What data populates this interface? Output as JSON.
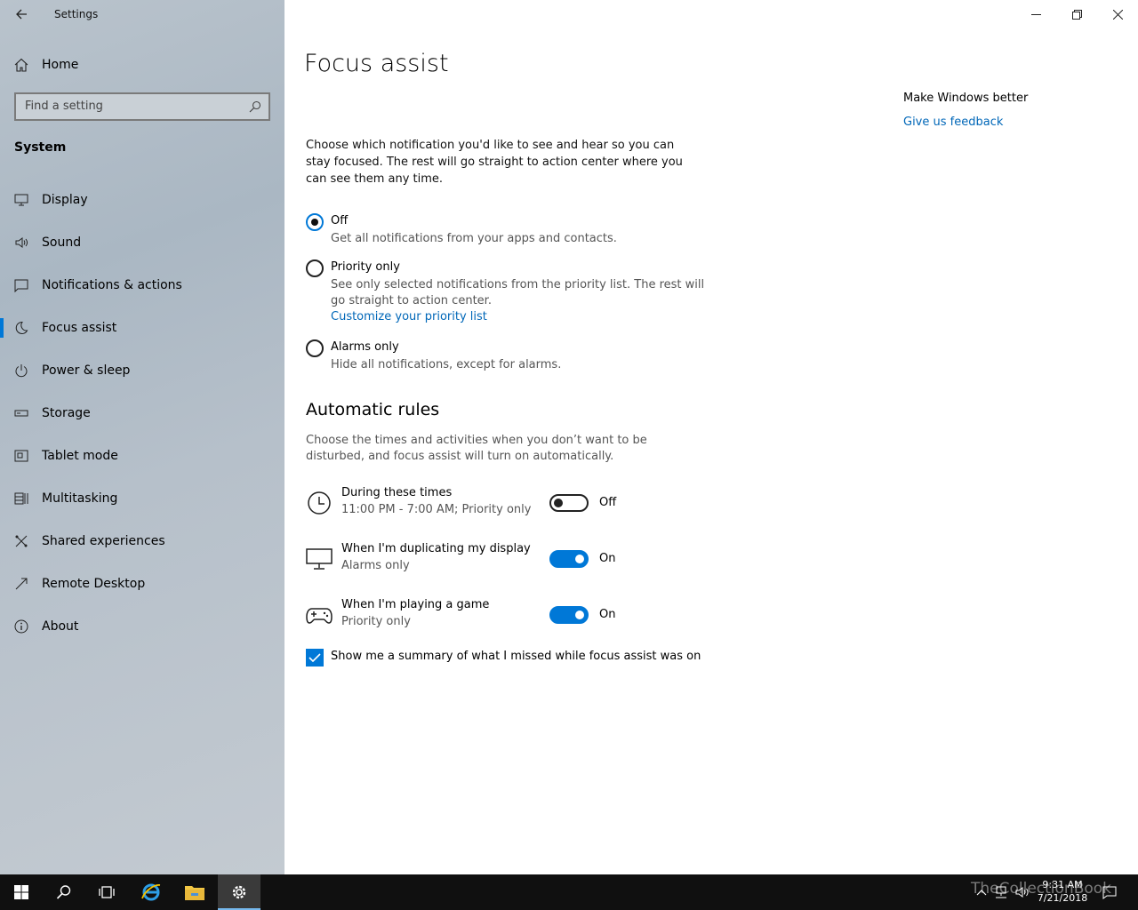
{
  "window": {
    "app_title": "Settings"
  },
  "sidebar": {
    "home_label": "Home",
    "search_placeholder": "Find a setting",
    "section_title": "System",
    "items": [
      {
        "label": "Display",
        "icon": "display-icon"
      },
      {
        "label": "Sound",
        "icon": "sound-icon"
      },
      {
        "label": "Notifications & actions",
        "icon": "notifications-icon"
      },
      {
        "label": "Focus assist",
        "icon": "moon-icon",
        "active": true
      },
      {
        "label": "Power & sleep",
        "icon": "power-icon"
      },
      {
        "label": "Storage",
        "icon": "storage-icon"
      },
      {
        "label": "Tablet mode",
        "icon": "tablet-icon"
      },
      {
        "label": "Multitasking",
        "icon": "multitasking-icon"
      },
      {
        "label": "Shared experiences",
        "icon": "shared-icon"
      },
      {
        "label": "Remote Desktop",
        "icon": "remote-desktop-icon"
      },
      {
        "label": "About",
        "icon": "info-icon"
      }
    ]
  },
  "main": {
    "title": "Focus assist",
    "description": "Choose which notification you'd like to see and hear so you can stay focused. The rest will go straight to action center where you can see them any time.",
    "options": [
      {
        "label": "Off",
        "sub": "Get all notifications from your apps and contacts.",
        "checked": true
      },
      {
        "label": "Priority only",
        "sub": "See only selected notifications from the priority list. The rest will go straight to action center.",
        "link": "Customize your priority list",
        "checked": false
      },
      {
        "label": "Alarms only",
        "sub": "Hide all notifications, except for alarms.",
        "checked": false
      }
    ],
    "rules_heading": "Automatic rules",
    "rules_description": "Choose the times and activities when you don’t want to be disturbed, and focus assist will turn on automatically.",
    "rules": [
      {
        "title": "During these times",
        "sub": "11:00 PM - 7:00 AM; Priority only",
        "state": "Off",
        "on": false,
        "icon": "clock-icon"
      },
      {
        "title": "When I'm duplicating my display",
        "sub": "Alarms only",
        "state": "On",
        "on": true,
        "icon": "monitor-icon"
      },
      {
        "title": "When I'm playing a game",
        "sub": "Priority only",
        "state": "On",
        "on": true,
        "icon": "gamepad-icon"
      }
    ],
    "summary_checkbox": "Show me a summary of what I missed while focus assist was on"
  },
  "right": {
    "title": "Make Windows better",
    "link": "Give us feedback"
  },
  "taskbar": {
    "time": "9:31 AM",
    "date": "7/21/2018",
    "watermark": "TheCollectionBook"
  },
  "colors": {
    "accent": "#0078d7",
    "link": "#0067b8",
    "taskbar": "#101010"
  }
}
